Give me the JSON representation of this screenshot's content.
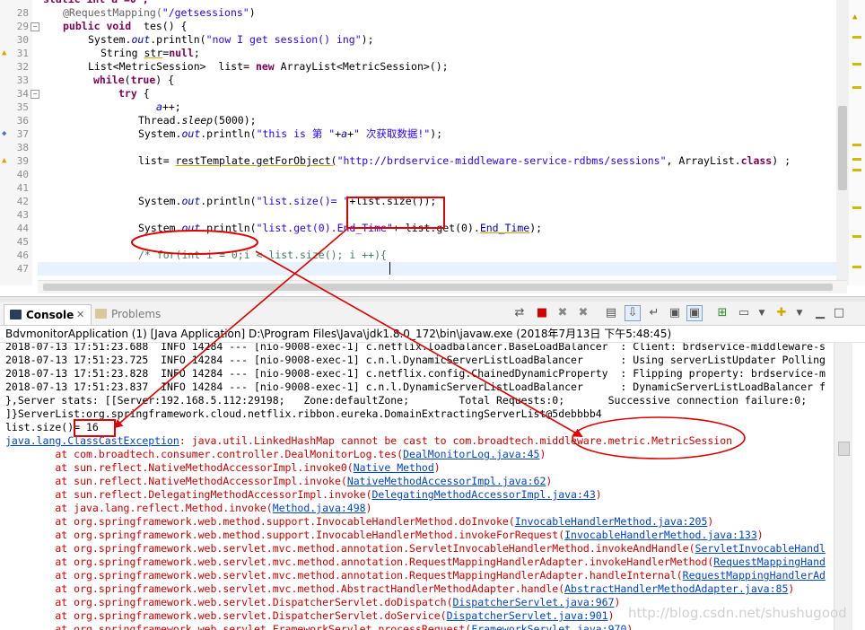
{
  "editor": {
    "line_numbers": [
      "28",
      "29",
      "30",
      "31",
      "32",
      "33",
      "34",
      "35",
      "36",
      "37",
      "38",
      "39",
      "40",
      "41",
      "42",
      "43",
      "44",
      "45",
      "46",
      "47"
    ],
    "lines": [
      {
        "kw1": "",
        "ann": "@RequestMapping(",
        "str": "\"/getsessions\"",
        "rest": ")"
      },
      {
        "kw1": "public void",
        "rest": "  tes() {"
      },
      {
        "pre": "System.",
        "fld": "out",
        "mid": ".println(",
        "str": "\"now I get session() ing\"",
        "rest": ");"
      },
      {
        "pre": "String ",
        "unl": "str",
        "mid": "=",
        "kw1": "null",
        "rest": ";"
      },
      {
        "pre": "List<MetricSession>  list= ",
        "kw1": "new",
        "rest": " ArrayList<MetricSession>();"
      },
      {
        "kw1": "while",
        "mid": "(",
        "kw2": "true",
        "rest": ") {"
      },
      {
        "kw1": "try",
        "rest": " {"
      },
      {
        "fld": "a",
        "rest": "++;"
      },
      {
        "pre": "Thread.",
        "ital": "sleep",
        "rest": "(5000);"
      },
      {
        "pre": "System.",
        "fld": "out",
        "mid": ".println(",
        "str": "\"this is 第 \"",
        "plus": "+",
        "fld2": "a",
        "plus2": "+",
        "str2": "\" 次获取数据!\"",
        "rest": ");"
      },
      {},
      {
        "pre": "list= ",
        "unl": "restTemplate.getForObject(",
        "str": "\"http://brdservice-middleware-service-rdbms/sessions\"",
        "mid": ", ArrayList.",
        "kw1": "class",
        "rest": ") ;"
      },
      {},
      {},
      {
        "pre": "System.",
        "fld": "out",
        "mid": ".println(",
        "str": "\"list.size()= \"",
        "rest": "+list.size());"
      },
      {},
      {
        "pre": "System.",
        "fld": "out",
        "mid": ".println(",
        "str": "\"list.get(0).End_Time\"",
        "rest": "+ list.get(0).",
        "fld2": "End_Time",
        "rest2": ");"
      },
      {},
      {
        "cmt": "/* for(int i = 0;i < list.size(); i ++){"
      },
      {}
    ],
    "top_partial": "static int a =0 ;"
  },
  "console_view": {
    "tabs": [
      {
        "label": "Console",
        "close": "✕"
      },
      {
        "label": "Problems"
      }
    ],
    "launch_description": "BdvmonitorApplication (1) [Java Application] D:\\Program Files\\Java\\jdk1.8.0_172\\bin\\javaw.exe (2018年7月13日 下午5:48:45)",
    "lines": [
      {
        "text": "2018-07-13 17:51:23.688  INFO 14284 --- [nio-9008-exec-1] c.netflix.loadbalancer.BaseLoadBalancer  : Client: brdservice-middleware-s"
      },
      {
        "text": "2018-07-13 17:51:23.725  INFO 14284 --- [nio-9008-exec-1] c.n.l.DynamicServerListLoadBalancer      : Using serverListUpdater Polling"
      },
      {
        "text": "2018-07-13 17:51:23.828  INFO 14284 --- [nio-9008-exec-1] c.netflix.config.ChainedDynamicProperty  : Flipping property: brdservice-m"
      },
      {
        "text": "2018-07-13 17:51:23.837  INFO 14284 --- [nio-9008-exec-1] c.n.l.DynamicServerListLoadBalancer      : DynamicServerListLoadBalancer f"
      },
      {
        "text": "},Server stats: [[Server:192.168.5.112:29198;   Zone:defaultZone;        Total Requests:0;       Successive connection failure:0;"
      },
      {
        "text": "]}ServerList:org.springframework.cloud.netflix.ribbon.eureka.DomainExtractingServerList@5debbbb4"
      },
      {
        "text": "list.size()= 16"
      }
    ],
    "exception": {
      "link": "java.lang.ClassCastException",
      "text": ": java.util.LinkedHashMap cannot be cast to com.broadtech.middleware.metric.MetricSession"
    },
    "stack": [
      {
        "pre": "        at com.broadtech.consumer.controller.DealMonitorLog.tes(",
        "link": "DealMonitorLog.java:45",
        "post": ")"
      },
      {
        "pre": "        at sun.reflect.NativeMethodAccessorImpl.invoke0(",
        "link": "Native Method",
        "post": ")"
      },
      {
        "pre": "        at sun.reflect.NativeMethodAccessorImpl.invoke(",
        "link": "NativeMethodAccessorImpl.java:62",
        "post": ")"
      },
      {
        "pre": "        at sun.reflect.DelegatingMethodAccessorImpl.invoke(",
        "link": "DelegatingMethodAccessorImpl.java:43",
        "post": ")"
      },
      {
        "pre": "        at java.lang.reflect.Method.invoke(",
        "link": "Method.java:498",
        "post": ")"
      },
      {
        "pre": "        at org.springframework.web.method.support.InvocableHandlerMethod.doInvoke(",
        "link": "InvocableHandlerMethod.java:205",
        "post": ")"
      },
      {
        "pre": "        at org.springframework.web.method.support.InvocableHandlerMethod.invokeForRequest(",
        "link": "InvocableHandlerMethod.java:133",
        "post": ")"
      },
      {
        "pre": "        at org.springframework.web.servlet.mvc.method.annotation.ServletInvocableHandlerMethod.invokeAndHandle(",
        "link": "ServletInvocableHandl",
        "post": ""
      },
      {
        "pre": "        at org.springframework.web.servlet.mvc.method.annotation.RequestMappingHandlerAdapter.invokeHandlerMethod(",
        "link": "RequestMappingHand",
        "post": ""
      },
      {
        "pre": "        at org.springframework.web.servlet.mvc.method.annotation.RequestMappingHandlerAdapter.handleInternal(",
        "link": "RequestMappingHandlerAd",
        "post": ""
      },
      {
        "pre": "        at org.springframework.web.servlet.mvc.method.AbstractHandlerMethodAdapter.handle(",
        "link": "AbstractHandlerMethodAdapter.java:85",
        "post": ")"
      },
      {
        "pre": "        at org.springframework.web.servlet.DispatcherServlet.doDispatch(",
        "link": "DispatcherServlet.java:967",
        "post": ")"
      },
      {
        "pre": "        at org.springframework.web.servlet.DispatcherServlet.doService(",
        "link": "DispatcherServlet.java:901",
        "post": ")"
      },
      {
        "pre": "        at org.springframework.web.servlet.FrameworkServlet.processRequest(",
        "link": "FrameworkServlet.java:970",
        "post": ")"
      }
    ],
    "watermark": "http://blog.csdn.net/shushugood"
  },
  "colors": {
    "annotation": "#e00000",
    "keyword": "#7f0055",
    "string": "#2a00ff",
    "error": "#d00000",
    "link": "#0044cc"
  }
}
